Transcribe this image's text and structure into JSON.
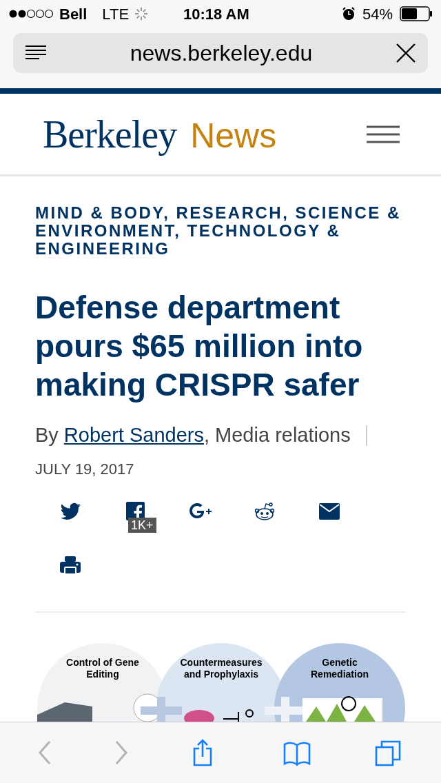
{
  "status_bar": {
    "carrier": "Bell",
    "network": "LTE",
    "time": "10:18 AM",
    "battery": "54%"
  },
  "browser": {
    "url": "news.berkeley.edu"
  },
  "site_header": {
    "logo_main": "Berkeley",
    "logo_section": "News"
  },
  "article": {
    "categories": "MIND & BODY, RESEARCH, SCIENCE & ENVIRONMENT, TECHNOLOGY & ENGINEERING",
    "title": "Defense department pours $65 million into making CRISPR safer",
    "byline_prefix": "By",
    "author": "Robert Sanders",
    "byline_suffix": ", Media relations",
    "date": "JULY 19, 2017",
    "share": [
      {
        "kind": "twitter"
      },
      {
        "kind": "facebook",
        "count": "1K+"
      },
      {
        "kind": "googleplus"
      },
      {
        "kind": "reddit"
      },
      {
        "kind": "email"
      },
      {
        "kind": "print"
      }
    ],
    "figure": [
      {
        "label": "Control of Gene Editing"
      },
      {
        "label": "Countermeasures and Prophylaxis"
      },
      {
        "label": "Genetic Remediation"
      }
    ]
  },
  "toolbar": [
    {
      "kind": "back",
      "disabled": true
    },
    {
      "kind": "forward",
      "disabled": true
    },
    {
      "kind": "share",
      "disabled": false
    },
    {
      "kind": "bookmarks",
      "disabled": false
    },
    {
      "kind": "tabs",
      "disabled": false
    }
  ]
}
